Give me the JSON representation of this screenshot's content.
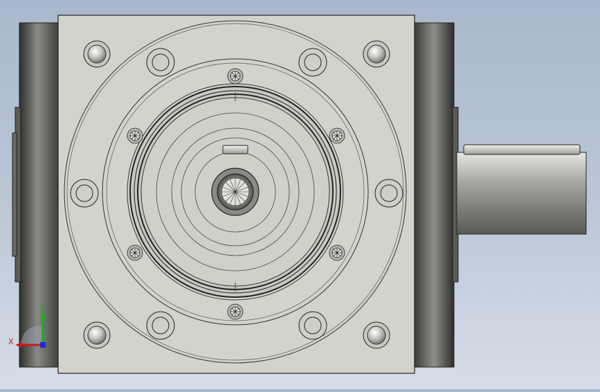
{
  "viewport": {
    "background_top": "#a9b8cc",
    "background_bottom": "#d6dde6",
    "part_face_color": "#d3d3cb",
    "housing_color": "#4a4a48",
    "shaft_color": "#9a9a96"
  },
  "triad": {
    "x_label": "X",
    "y_label": "Y",
    "x_color": "#d01818",
    "y_color": "#18b018",
    "z_color": "#1a2ae0"
  }
}
